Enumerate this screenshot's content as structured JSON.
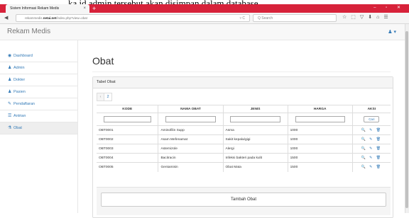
{
  "caption": "ka id admin tersebut akan disimpan dalam database.",
  "browser": {
    "tab_title": "Sistem Informasi Rekam Medis",
    "tab_close": "×",
    "new_tab": "+",
    "window_controls": "– ▫ ✕",
    "url_prefix": "rekammedis.",
    "url_domain": "netai.net",
    "url_path": "/index.php?view=obat",
    "url_controls": "▿ C",
    "search_placeholder": "Q  Search"
  },
  "app": {
    "brand": "Rekam Medis",
    "user_menu": "♟ ▾"
  },
  "sidebar": {
    "items": [
      {
        "icon": "dashboard-icon",
        "glyph": "◉",
        "label": "Dashboard"
      },
      {
        "icon": "user-icon",
        "glyph": "♟",
        "label": "Admin"
      },
      {
        "icon": "user-icon",
        "glyph": "♟",
        "label": "Dokter"
      },
      {
        "icon": "users-icon",
        "glyph": "♟",
        "label": "Pasien"
      },
      {
        "icon": "pencil-icon",
        "glyph": "✎",
        "label": "Pendaftaran"
      },
      {
        "icon": "list-icon",
        "glyph": "☰",
        "label": "Antrian"
      },
      {
        "icon": "flask-icon",
        "glyph": "⚗",
        "label": "Obat"
      }
    ]
  },
  "main": {
    "title": "Obat",
    "panel_title": "Tabel Obat",
    "pager": [
      "‹",
      "2"
    ],
    "columns": [
      "KODE",
      "NAMA OBAT",
      "JENIS",
      "HARGA",
      "AKSI"
    ],
    "search_button": "Cari",
    "rows": [
      {
        "kode": "OBT0001",
        "nama": "Aminofilin Supp",
        "jenis": "Asma",
        "harga": "1000"
      },
      {
        "kode": "OBT0002",
        "nama": "Asam Mefenamat",
        "jenis": "Sakit kepala/gigi",
        "harga": "1000"
      },
      {
        "kode": "OBT0003",
        "nama": "Astemizole",
        "jenis": "Alergi",
        "harga": "1000"
      },
      {
        "kode": "OBT0004",
        "nama": "Bacitracin",
        "jenis": "Infeksi bakteri pada kulit",
        "harga": "1500"
      },
      {
        "kode": "OBT0005",
        "nama": "Gentamisin",
        "jenis": "Obat Mata",
        "harga": "1500"
      }
    ],
    "row_actions": "🔍 ✎ 🗑",
    "add_button": "Tambah Obat"
  },
  "colors": {
    "tabbar": "#d7223a",
    "link": "#337ab7"
  }
}
